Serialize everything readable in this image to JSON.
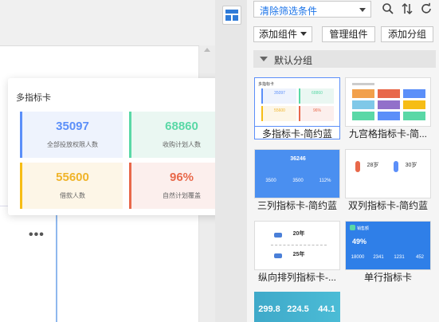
{
  "toolbar": {
    "filter_select": "清除筛选条件",
    "add_component": "添加组件",
    "manage_component": "管理组件",
    "add_group": "添加分组"
  },
  "group": {
    "title": "默认分组"
  },
  "card": {
    "title": "多指标卡",
    "metrics": [
      {
        "value": "35097",
        "label": "全部投放权限人数"
      },
      {
        "value": "68860",
        "label": "收购计划人数"
      },
      {
        "value": "55600",
        "label": "借款人数"
      },
      {
        "value": "96%",
        "label": "自然计划覆盖"
      }
    ]
  },
  "templates": [
    {
      "label": "多指标卡-简约蓝"
    },
    {
      "label": "九宫格指标卡-简..."
    },
    {
      "label": "三列指标卡-简约蓝"
    },
    {
      "label": "双列指标卡-简约蓝"
    },
    {
      "label": "纵向排列指标卡-..."
    },
    {
      "label": "单行指标卡"
    }
  ],
  "thumbs": {
    "t1": {
      "title": "多指标卡",
      "v1": "35097",
      "v2": "68860",
      "v3": "55600",
      "v4": "96%"
    },
    "t3": {
      "top": "36246",
      "a": "3500",
      "b": "3500",
      "c": "112%"
    },
    "t4": {
      "a": "28岁",
      "b": "30岁"
    },
    "t5": {
      "a": "20年",
      "b": "25年"
    },
    "t6": {
      "title": "销售额",
      "pct": "49%",
      "a": "18000",
      "b": "2341",
      "c": "1231",
      "d": "452"
    },
    "t7": {
      "a": "299.8",
      "b": "224.5",
      "c": "44.1"
    }
  },
  "colors": {
    "blue": "#5b8ff9",
    "green": "#5ad8a6",
    "yellow": "#f6bd16",
    "red": "#e8684a",
    "link": "#1a73e8"
  }
}
